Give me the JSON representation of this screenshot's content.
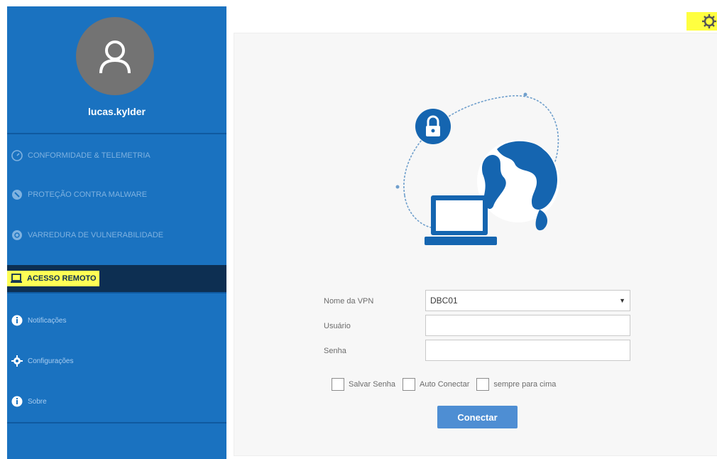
{
  "user": {
    "name": "lucas.kylder"
  },
  "nav": {
    "items": [
      {
        "label": "CONFORMIDADE & TELEMETRIA",
        "icon": "gauge-icon"
      },
      {
        "label": "PROTEÇÃO CONTRA MALWARE",
        "icon": "shield-icon"
      },
      {
        "label": "VARREDURA DE VULNERABILIDADE",
        "icon": "radar-icon"
      },
      {
        "label": "ACESSO REMOTO",
        "icon": "laptop-icon",
        "active": true
      },
      {
        "label": "Notificações",
        "icon": "info-icon"
      },
      {
        "label": "Configurações",
        "icon": "gear-icon"
      },
      {
        "label": "Sobre",
        "icon": "info-icon"
      }
    ]
  },
  "form": {
    "vpn_label": "Nome da VPN",
    "vpn_value": "DBC01",
    "user_label": "Usuário",
    "user_value": "",
    "password_label": "Senha",
    "password_value": "",
    "checkboxes": [
      "Salvar Senha",
      "Auto Conectar",
      "sempre para cima"
    ],
    "connect_button": "Conectar"
  },
  "colors": {
    "sidebar": "#1a72c0",
    "active_item": "#0d2f52",
    "highlight": "#ffff55",
    "button": "#4e8ed3"
  }
}
